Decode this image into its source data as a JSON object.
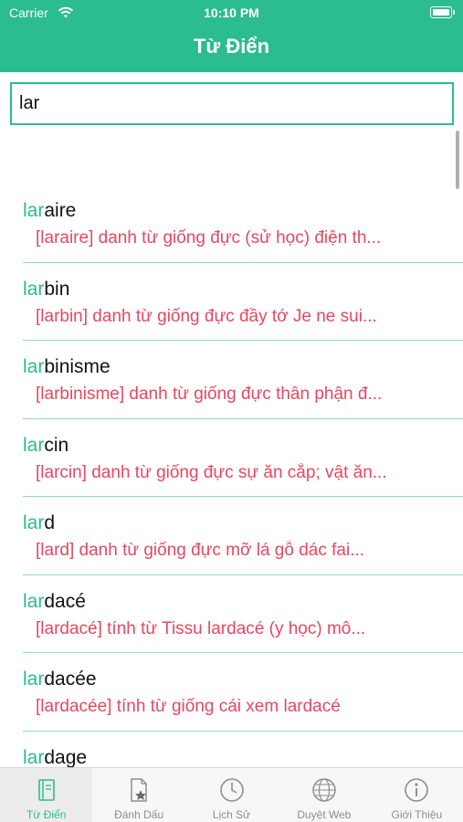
{
  "status_bar": {
    "carrier": "Carrier",
    "time": "10:10 PM"
  },
  "nav": {
    "title": "Từ Điển"
  },
  "search": {
    "value": "lar"
  },
  "results": [
    {
      "prefix": "lar",
      "rest": "aire",
      "definition": "[laraire]   danh từ giống đực   (sử học) điện th..."
    },
    {
      "prefix": "lar",
      "rest": "bin",
      "definition": "[larbin]   danh từ giống đực   đầy tớ   Je ne sui..."
    },
    {
      "prefix": "lar",
      "rest": "binisme",
      "definition": "[larbinisme]   danh từ giống đực   thân phận đ..."
    },
    {
      "prefix": "lar",
      "rest": "cin",
      "definition": "[larcin]   danh từ giống đực   sự ăn cắp; vật ăn..."
    },
    {
      "prefix": "lar",
      "rest": "d",
      "definition": "[lard]   danh từ giống đực   mỡ lá   gỗ dác   fai..."
    },
    {
      "prefix": "lar",
      "rest": "dacé",
      "definition": "[lardacé]   tính từ   Tissu lardacé   (y học) mô..."
    },
    {
      "prefix": "lar",
      "rest": "dacée",
      "definition": "[lardacée]   tính từ giống cái   xem lardacé"
    },
    {
      "prefix": "lar",
      "rest": "dage",
      "definition": ""
    }
  ],
  "tabs": [
    {
      "label": "Từ Điển",
      "icon": "dictionary-icon",
      "active": true
    },
    {
      "label": "Đánh Dấu",
      "icon": "bookmark-icon",
      "active": false
    },
    {
      "label": "Lịch Sử",
      "icon": "clock-icon",
      "active": false
    },
    {
      "label": "Duyệt Web",
      "icon": "globe-icon",
      "active": false
    },
    {
      "label": "Giới Thiệu",
      "icon": "info-icon",
      "active": false
    }
  ],
  "colors": {
    "accent": "#2bbc8f",
    "definition": "#e8475f"
  }
}
